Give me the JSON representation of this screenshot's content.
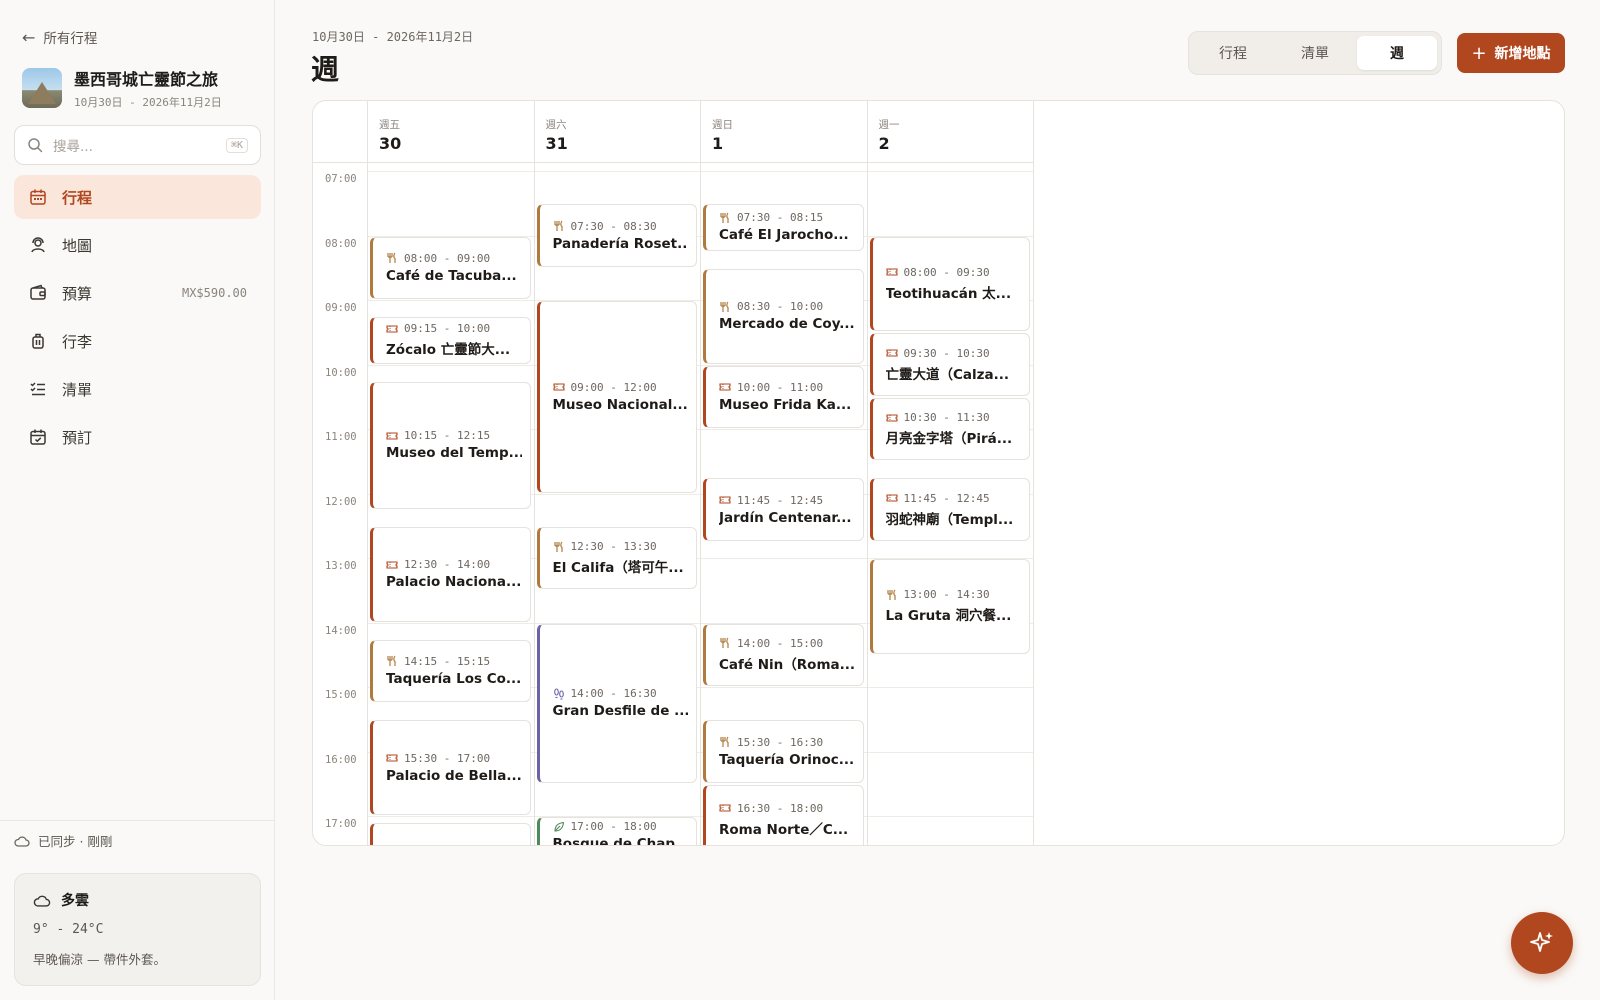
{
  "sidebar": {
    "back_label": "所有行程",
    "trip": {
      "title": "墨西哥城亡靈節之旅",
      "dates": "10月30日 - 2026年11月2日"
    },
    "search": {
      "placeholder": "搜尋...",
      "shortcut": "⌘K"
    },
    "nav": [
      {
        "label": "行程",
        "icon": "calendar-icon",
        "active": true
      },
      {
        "label": "地圖",
        "icon": "map-pin-icon"
      },
      {
        "label": "預算",
        "icon": "wallet-icon",
        "extra": "MX$590.00"
      },
      {
        "label": "行李",
        "icon": "luggage-icon"
      },
      {
        "label": "清單",
        "icon": "checklist-icon"
      },
      {
        "label": "預訂",
        "icon": "booking-calendar-icon"
      }
    ],
    "sync_status": "已同步 · 剛剛",
    "weather": {
      "condition": "多雲",
      "temp": "9° - 24°C",
      "note": "早晚偏涼 — 帶件外套。"
    }
  },
  "header": {
    "range": "10月30日 - 2026年11月2日",
    "title": "週",
    "views": [
      "行程",
      "清單",
      "週"
    ],
    "active_view": "週",
    "add_label": "新增地點"
  },
  "calendar": {
    "hours": [
      "07:00",
      "08:00",
      "09:00",
      "10:00",
      "11:00",
      "12:00",
      "13:00",
      "14:00",
      "15:00",
      "16:00",
      "17:00"
    ],
    "days": [
      {
        "dow": "週五",
        "num": "30",
        "events": [
          {
            "time": "08:00 - 09:00",
            "title": "Café de Tacuba...",
            "kind": "food",
            "start": 8.0,
            "end": 9.0
          },
          {
            "time": "09:15 - 10:00",
            "title": "Zócalo 亡靈節大...",
            "kind": "sight",
            "start": 9.25,
            "end": 10.0
          },
          {
            "time": "10:15 - 12:15",
            "title": "Museo del Temp...",
            "kind": "sight",
            "start": 10.25,
            "end": 12.25
          },
          {
            "time": "12:30 - 14:00",
            "title": "Palacio Naciona...",
            "kind": "sight",
            "start": 12.5,
            "end": 14.0
          },
          {
            "time": "14:15 - 15:15",
            "title": "Taquería Los Co...",
            "kind": "food",
            "start": 14.25,
            "end": 15.25
          },
          {
            "time": "15:30 - 17:00",
            "title": "Palacio de Bella...",
            "kind": "sight",
            "start": 15.5,
            "end": 17.0
          },
          {
            "time": "",
            "title": "",
            "kind": "sight",
            "start": 17.1,
            "end": 18.0
          }
        ]
      },
      {
        "dow": "週六",
        "num": "31",
        "events": [
          {
            "time": "07:30 - 08:30",
            "title": "Panadería Roset...",
            "kind": "food",
            "start": 7.5,
            "end": 8.5
          },
          {
            "time": "09:00 - 12:00",
            "title": "Museo Nacional...",
            "kind": "sight",
            "start": 9.0,
            "end": 12.0
          },
          {
            "time": "12:30 - 13:30",
            "title": "El Califa（塔可午...",
            "kind": "food",
            "start": 12.5,
            "end": 13.5
          },
          {
            "time": "14:00 - 16:30",
            "title": "Gran Desfile de ...",
            "kind": "event-kind",
            "start": 14.0,
            "end": 16.5
          },
          {
            "time": "17:00 - 18:00",
            "title": "Bosque de Chap...",
            "kind": "park",
            "start": 17.0,
            "end": 18.0
          }
        ]
      },
      {
        "dow": "週日",
        "num": "1",
        "events": [
          {
            "time": "07:30 - 08:15",
            "title": "Café El Jarocho...",
            "kind": "food",
            "start": 7.5,
            "end": 8.25
          },
          {
            "time": "08:30 - 10:00",
            "title": "Mercado de Coy...",
            "kind": "food",
            "start": 8.5,
            "end": 10.0
          },
          {
            "time": "10:00 - 11:00",
            "title": "Museo Frida Ka...",
            "kind": "sight",
            "start": 10.0,
            "end": 11.0
          },
          {
            "time": "11:45 - 12:45",
            "title": "Jardín Centenar...",
            "kind": "sight",
            "start": 11.75,
            "end": 12.75
          },
          {
            "time": "14:00 - 15:00",
            "title": "Café Nin（Roma...",
            "kind": "food",
            "start": 14.0,
            "end": 15.0
          },
          {
            "time": "15:30 - 16:30",
            "title": "Taquería Orinoc...",
            "kind": "food",
            "start": 15.5,
            "end": 16.5
          },
          {
            "time": "16:30 - 18:00",
            "title": "Roma Norte／C...",
            "kind": "sight",
            "start": 16.5,
            "end": 18.0
          }
        ]
      },
      {
        "dow": "週一",
        "num": "2",
        "events": [
          {
            "time": "08:00 - 09:30",
            "title": "Teotihuacán 太...",
            "kind": "sight",
            "start": 8.0,
            "end": 9.5
          },
          {
            "time": "09:30 - 10:30",
            "title": "亡靈大道（Calza...",
            "kind": "sight",
            "start": 9.5,
            "end": 10.5
          },
          {
            "time": "10:30 - 11:30",
            "title": "月亮金字塔（Pirá...",
            "kind": "sight",
            "start": 10.5,
            "end": 11.5
          },
          {
            "time": "11:45 - 12:45",
            "title": "羽蛇神廟（Templ...",
            "kind": "sight",
            "start": 11.75,
            "end": 12.75
          },
          {
            "time": "13:00 - 14:30",
            "title": "La Gruta 洞穴餐...",
            "kind": "food",
            "start": 13.0,
            "end": 14.5
          }
        ]
      }
    ]
  },
  "colors": {
    "accent": "#b0471f",
    "accent_soft": "#fbe6dc",
    "food": "#b07a3e",
    "event": "#6b63a8",
    "park": "#4f8a5b"
  }
}
